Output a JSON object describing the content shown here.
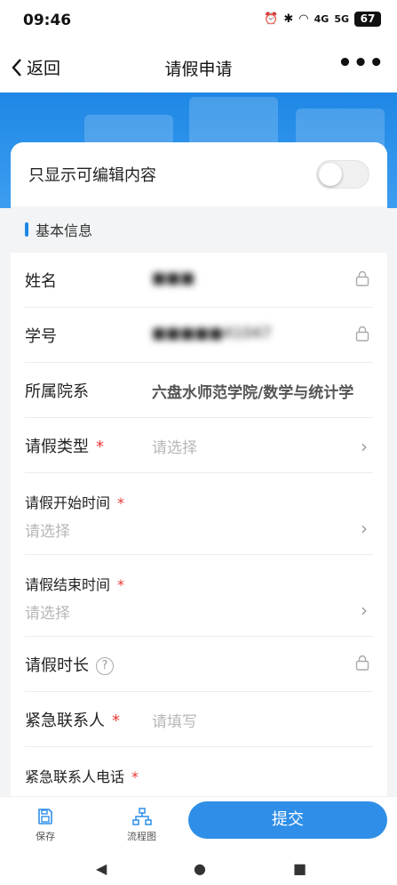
{
  "status": {
    "time": "09:46",
    "signal1": "4G",
    "signal2": "5G",
    "battery": "67"
  },
  "nav": {
    "back_label": "返回",
    "title": "请假申请",
    "more": "•••"
  },
  "toggle": {
    "label": "只显示可编辑内容",
    "on": false
  },
  "section": {
    "title": "基本信息"
  },
  "fields": {
    "name": {
      "label": "姓名",
      "value": "■■■"
    },
    "student_no": {
      "label": "学号",
      "value": "■■■■■41047"
    },
    "dept": {
      "label": "所属院系",
      "value": "六盘水师范学院/数学与统计学"
    },
    "leave_type": {
      "label": "请假类型",
      "required": "*",
      "placeholder": "请选择"
    },
    "start": {
      "label": "请假开始时间",
      "required": "*",
      "placeholder": "请选择"
    },
    "end": {
      "label": "请假结束时间",
      "required": "*",
      "placeholder": "请选择"
    },
    "duration": {
      "label": "请假时长",
      "help": "?"
    },
    "contact": {
      "label": "紧急联系人",
      "required": "*",
      "placeholder": "请填写"
    },
    "contact_phone": {
      "label": "紧急联系人电话",
      "required": "*"
    }
  },
  "bottom": {
    "save_label": "保存",
    "flow_label": "流程图",
    "submit_label": "提交"
  },
  "colors": {
    "accent": "#1e88e5",
    "required": "#e53935"
  }
}
